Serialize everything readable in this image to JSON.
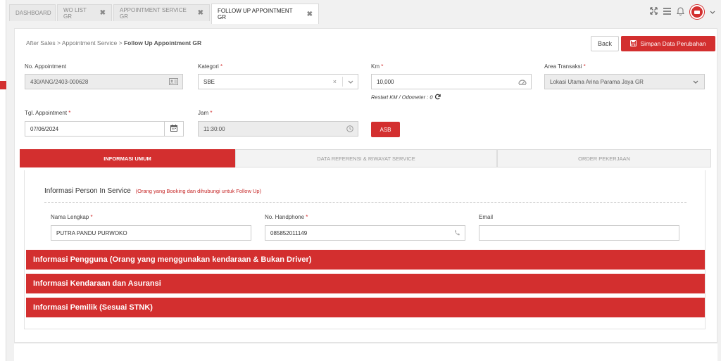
{
  "tabs": [
    {
      "label": "DASHBOARD",
      "closable": false,
      "active": false
    },
    {
      "label": "WO LIST GR",
      "closable": true,
      "active": false
    },
    {
      "label": "APPOINTMENT SERVICE GR",
      "closable": true,
      "active": false
    },
    {
      "label": "FOLLOW UP APPOINTMENT GR",
      "closable": true,
      "active": true
    }
  ],
  "tab_close_glyph": "✖",
  "topbar": {
    "icons": [
      "expand-icon",
      "menu-icon",
      "bell-icon",
      "avatar",
      "chevron-down-icon"
    ]
  },
  "breadcrumb": {
    "level1": "After Sales",
    "level2": "Appointment Service",
    "current": "Follow Up Appointment GR",
    "sep": ">"
  },
  "buttons": {
    "back": "Back",
    "save": "Simpan Data Perubahan",
    "asb": "ASB"
  },
  "form": {
    "no_appointment": {
      "label": "No. Appointment",
      "value": "430/ANG/2403-000628"
    },
    "kategori": {
      "label": "Kategori",
      "value": "SBE"
    },
    "km": {
      "label": "Km",
      "value": "10,000"
    },
    "area_transaksi": {
      "label": "Area Transaksi",
      "value": "Lokasi Utama Arina Parama Jaya GR"
    },
    "tgl_appointment": {
      "label": "Tgl. Appointment",
      "value": "07/06/2024"
    },
    "jam": {
      "label": "Jam",
      "value": "11:30:00"
    },
    "restart_km": "Restart KM / Odometer : 0"
  },
  "required_mark": "*",
  "section_tabs": [
    {
      "label": "INFORMASI UMUM",
      "active": true
    },
    {
      "label": "DATA REFERENSI & RIWAYAT SERVICE",
      "active": false
    },
    {
      "label": "ORDER PEKERJAAN",
      "active": false
    }
  ],
  "person": {
    "title": "Informasi Person In Service",
    "subtitle": "(Orang yang Booking dan dihubungi untuk Follow Up)",
    "nama": {
      "label": "Nama Lengkap",
      "value": "PUTRA PANDU PURWOKO"
    },
    "hp": {
      "label": "No. Handphone",
      "value": "085852011149"
    },
    "email": {
      "label": "Email",
      "value": ""
    }
  },
  "accordions": [
    "Informasi Pengguna (Orang yang menggunakan kendaraan & Bukan Driver)",
    "Informasi Kendaraan dan Asuransi",
    "Informasi Pemilik (Sesuai STNK)"
  ],
  "colors": {
    "accent": "#d32f2f",
    "disabled_bg": "#ececec"
  }
}
